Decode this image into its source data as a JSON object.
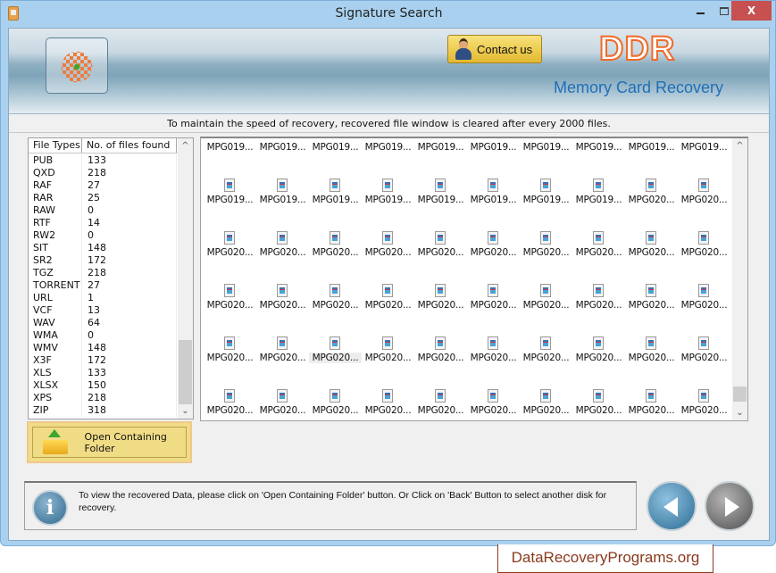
{
  "window": {
    "title": "Signature Search",
    "close_label": "X"
  },
  "banner": {
    "contact_label": "Contact us",
    "brand": "DDR",
    "product": "Memory Card Recovery"
  },
  "notice": "To maintain the speed of recovery, recovered file window is cleared after every 2000 files.",
  "file_types": {
    "headers": [
      "File Types",
      "No. of files found"
    ],
    "rows": [
      {
        "type": "PUB",
        "count": "133"
      },
      {
        "type": "QXD",
        "count": "218"
      },
      {
        "type": "RAF",
        "count": "27"
      },
      {
        "type": "RAR",
        "count": "25"
      },
      {
        "type": "RAW",
        "count": "0"
      },
      {
        "type": "RTF",
        "count": "14"
      },
      {
        "type": "RW2",
        "count": "0"
      },
      {
        "type": "SIT",
        "count": "148"
      },
      {
        "type": "SR2",
        "count": "172"
      },
      {
        "type": "TGZ",
        "count": "218"
      },
      {
        "type": "TORRENT",
        "count": "27"
      },
      {
        "type": "URL",
        "count": "1"
      },
      {
        "type": "VCF",
        "count": "13"
      },
      {
        "type": "WAV",
        "count": "64"
      },
      {
        "type": "WMA",
        "count": "0"
      },
      {
        "type": "WMV",
        "count": "148"
      },
      {
        "type": "X3F",
        "count": "172"
      },
      {
        "type": "XLS",
        "count": "133"
      },
      {
        "type": "XLSX",
        "count": "150"
      },
      {
        "type": "XPS",
        "count": "218"
      },
      {
        "type": "ZIP",
        "count": "318"
      }
    ]
  },
  "open_folder_label": "Open Containing Folder",
  "recovered_files": {
    "rows": [
      [
        "MPG019...",
        "MPG019...",
        "MPG019...",
        "MPG019...",
        "MPG019...",
        "MPG019...",
        "MPG019...",
        "MPG019...",
        "MPG019...",
        "MPG019..."
      ],
      [
        "MPG019...",
        "MPG019...",
        "MPG019...",
        "MPG019...",
        "MPG019...",
        "MPG019...",
        "MPG019...",
        "MPG019...",
        "MPG020...",
        "MPG020..."
      ],
      [
        "MPG020...",
        "MPG020...",
        "MPG020...",
        "MPG020...",
        "MPG020...",
        "MPG020...",
        "MPG020...",
        "MPG020...",
        "MPG020...",
        "MPG020..."
      ],
      [
        "MPG020...",
        "MPG020...",
        "MPG020...",
        "MPG020...",
        "MPG020...",
        "MPG020...",
        "MPG020...",
        "MPG020...",
        "MPG020...",
        "MPG020..."
      ],
      [
        "MPG020...",
        "MPG020...",
        "MPG020...",
        "MPG020...",
        "MPG020...",
        "MPG020...",
        "MPG020...",
        "MPG020...",
        "MPG020...",
        "MPG020..."
      ],
      [
        "MPG020...",
        "MPG020...",
        "MPG020...",
        "MPG020...",
        "MPG020...",
        "MPG020...",
        "MPG020...",
        "MPG020...",
        "MPG020...",
        "MPG020..."
      ]
    ],
    "selected": {
      "row": 4,
      "col": 2
    },
    "icon": "video-file-icon"
  },
  "status": {
    "icon": "info-icon",
    "text": "To view the recovered Data, please click on 'Open Containing Folder' button. Or Click on 'Back' Button to select another disk for recovery."
  },
  "nav": {
    "back_icon": "back-arrow-icon",
    "next_icon": "next-arrow-icon"
  },
  "watermark": "DataRecoveryPrograms.org",
  "colors": {
    "brand_orange": "#f06a28",
    "product_blue": "#1f6fb8",
    "close_red": "#c75050",
    "button_yellow": "#f1dc86"
  }
}
